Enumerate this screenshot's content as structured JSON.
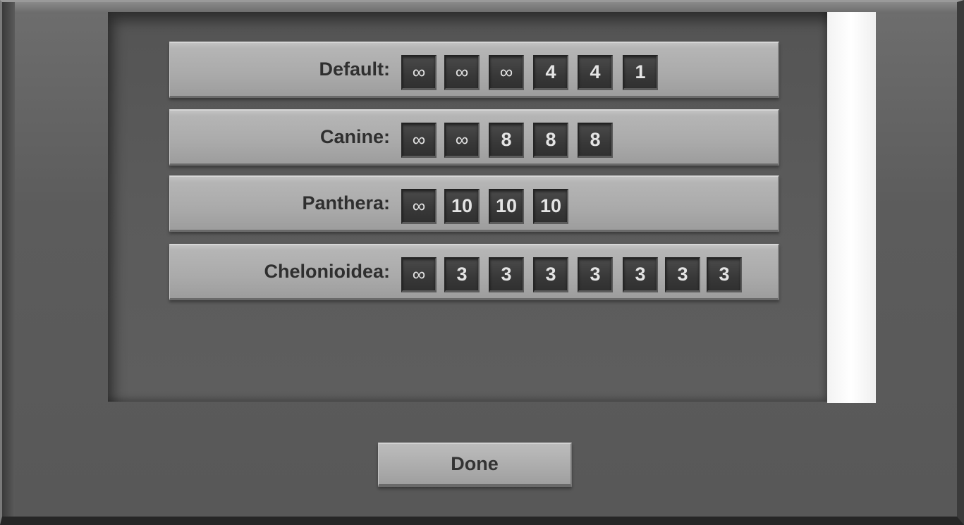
{
  "rows": [
    {
      "label": "Default:",
      "slots": [
        "∞",
        "∞",
        "∞",
        "4",
        "4",
        "1"
      ]
    },
    {
      "label": "Canine:",
      "slots": [
        "∞",
        "∞",
        "8",
        "8",
        "8"
      ]
    },
    {
      "label": "Panthera:",
      "slots": [
        "∞",
        "10",
        "10",
        "10"
      ]
    },
    {
      "label": "Chelonioidea:",
      "slots": [
        "∞",
        "3",
        "3",
        "3",
        "3",
        "3",
        "3",
        "3"
      ]
    }
  ],
  "done_button": {
    "label": "Done"
  }
}
